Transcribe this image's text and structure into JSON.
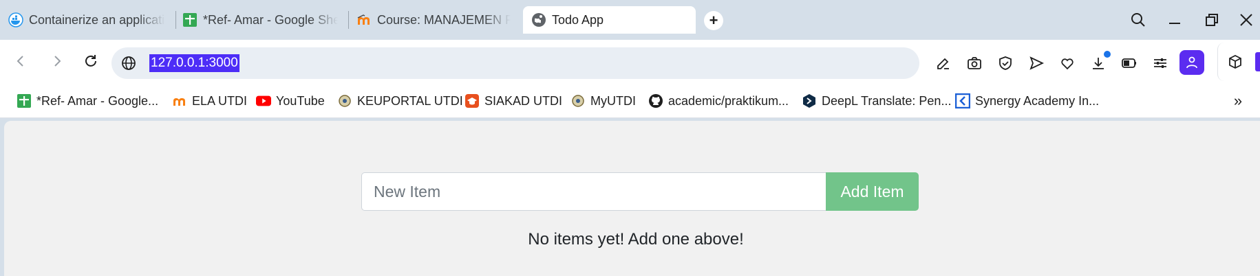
{
  "browser": {
    "tabs": [
      {
        "label": "Containerize an applicatio",
        "icon": "docker-icon",
        "active": false
      },
      {
        "label": "*Ref- Amar - Google Shee",
        "icon": "google-sheets-icon",
        "active": false
      },
      {
        "label": "Course: MANAJEMEN RES",
        "icon": "moodle-icon",
        "active": false
      },
      {
        "label": "Todo App",
        "icon": "globe-icon",
        "active": true
      }
    ],
    "address_bar": {
      "url": "127.0.0.1:3000"
    },
    "bookmarks": [
      {
        "label": "*Ref- Amar - Google...",
        "icon": "google-sheets-icon"
      },
      {
        "label": "ELA UTDI",
        "icon": "moodle-icon"
      },
      {
        "label": "YouTube",
        "icon": "youtube-icon"
      },
      {
        "label": "KEUPORTAL UTDI",
        "icon": "utdi-logo-icon"
      },
      {
        "label": "SIAKAD UTDI",
        "icon": "siakad-icon"
      },
      {
        "label": "MyUTDI",
        "icon": "utdi-logo-icon"
      },
      {
        "label": "academic/praktikum...",
        "icon": "github-icon"
      },
      {
        "label": "DeepL Translate: Pen...",
        "icon": "deepl-icon"
      },
      {
        "label": "Synergy Academy In...",
        "icon": "synergy-icon"
      }
    ],
    "colors": {
      "accent": "#5b2cf0",
      "url_highlight": "#4d2df7",
      "tab_strip": "#d5dfe9"
    }
  },
  "app": {
    "input_placeholder": "New Item",
    "add_button_label": "Add Item",
    "empty_message": "No items yet! Add one above!",
    "colors": {
      "add_button": "#72c48a",
      "page_bg": "#f1f1f1"
    }
  }
}
